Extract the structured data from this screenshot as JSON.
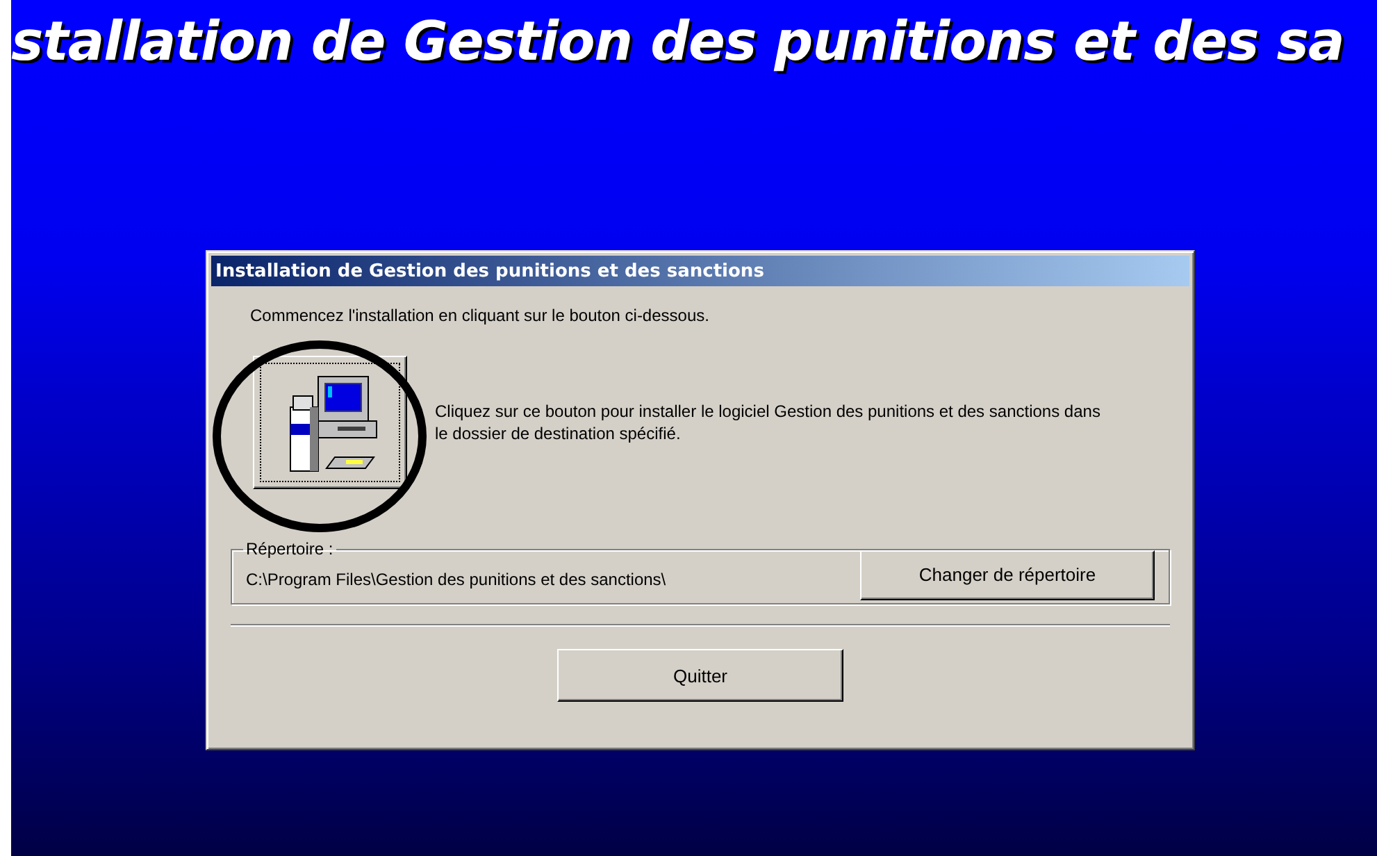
{
  "banner": {
    "title": "stallation de Gestion des punitions et des sa"
  },
  "dialog": {
    "title": "Installation de Gestion des punitions et des sanctions",
    "intro": "Commencez l'installation en cliquant sur le bouton ci-dessous.",
    "install_description": "Cliquez sur ce bouton pour installer le logiciel Gestion des punitions et des sanctions dans le dossier de destination spécifié.",
    "directory": {
      "legend": "Répertoire :",
      "path": "C:\\Program Files\\Gestion des punitions et des sanctions\\",
      "button": "Changer de répertoire"
    },
    "buttons": [
      "Quitter"
    ]
  },
  "annotation": {
    "kind": "circle"
  }
}
